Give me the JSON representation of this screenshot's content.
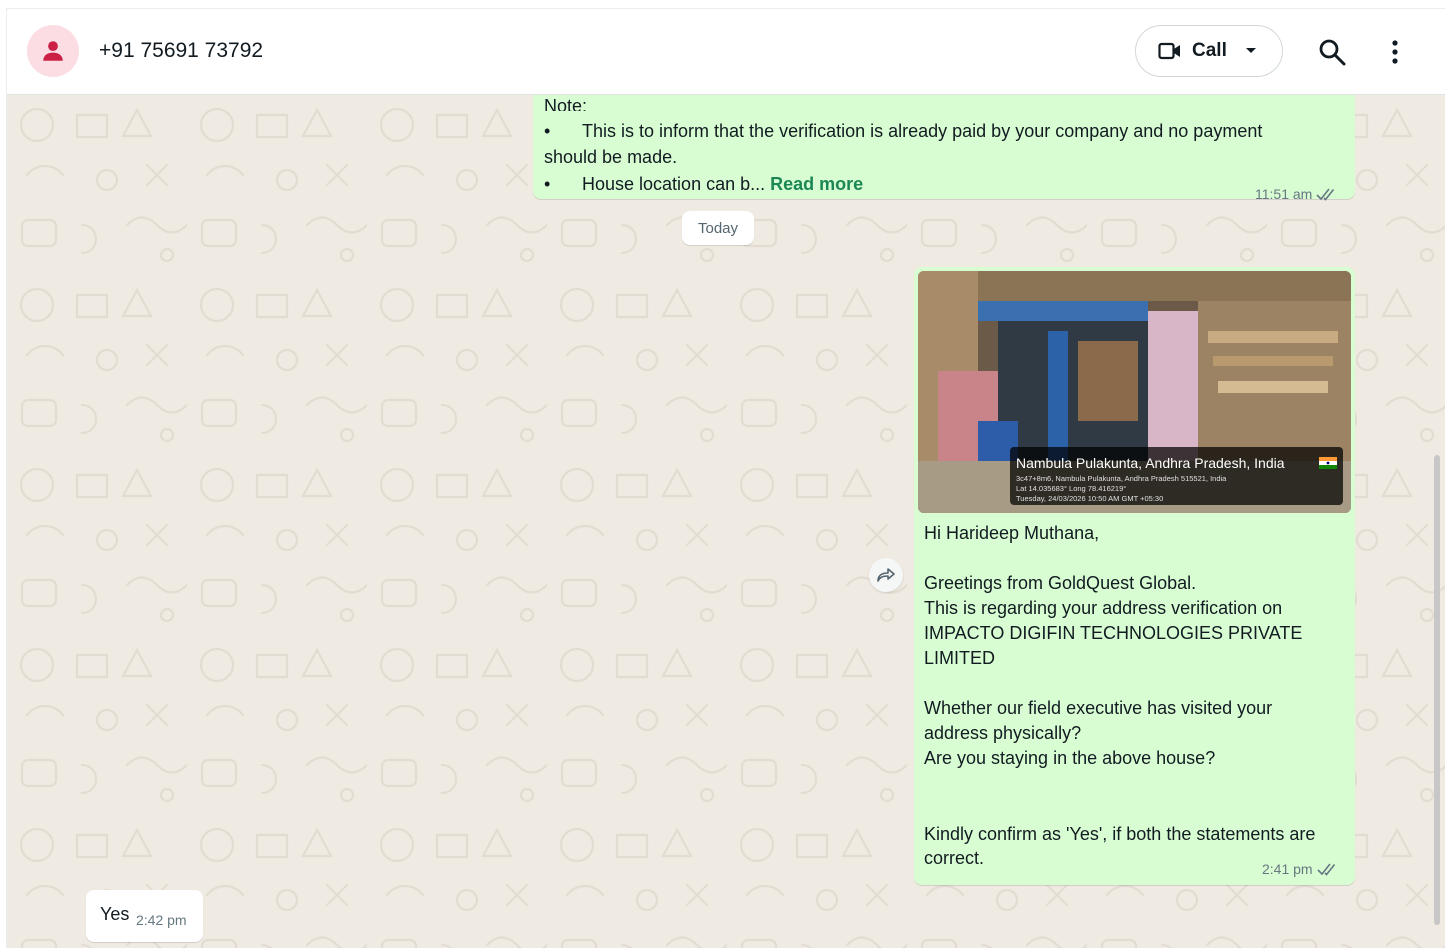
{
  "header": {
    "contact_name": "+91 75691 73792",
    "avatar_icon": "person-icon",
    "call_label": "Call",
    "icons": [
      "video-call-icon",
      "chevron-down-icon",
      "search-icon",
      "more-options-icon"
    ]
  },
  "messages": {
    "top": {
      "partial_label": "Note:",
      "line1": "This is to inform that the verification is already paid by your company and no payment",
      "line2": "should be made.",
      "line3": "House location can b...",
      "read_more": "Read more",
      "time": "11:51 am"
    },
    "date_divider": "Today",
    "main": {
      "photo_geotag": {
        "title": "Nambula Pulakunta, Andhra Pradesh, India",
        "address": "3c47+8m6, Nambula Pulakunta, Andhra Pradesh 515521, India",
        "coords": "Lat 14.035683° Long 78.416219°",
        "datetime": "Tuesday, 24/03/2026 10:50 AM GMT +05:30"
      },
      "lines": [
        "Hi Harideep Muthana,",
        "Greetings from GoldQuest Global.",
        "This is regarding your address verification on",
        "IMPACTO DIGIFIN TECHNOLOGIES PRIVATE",
        "LIMITED",
        "Whether our field executive has visited your",
        "address physically?",
        "Are you staying in the above house?",
        "Kindly confirm as 'Yes', if both the statements are",
        "correct."
      ],
      "time": "2:41 pm"
    },
    "reply": {
      "text": "Yes",
      "time": "2:42 pm"
    }
  },
  "colors": {
    "outgoing_bubble": "#d9fdd3",
    "incoming_bubble": "#ffffff",
    "chat_background": "#efeae2",
    "avatar_bg": "#fbdde3",
    "avatar_icon": "#cc1f46",
    "read_more": "#1b8755",
    "timestamp": "#667781"
  }
}
